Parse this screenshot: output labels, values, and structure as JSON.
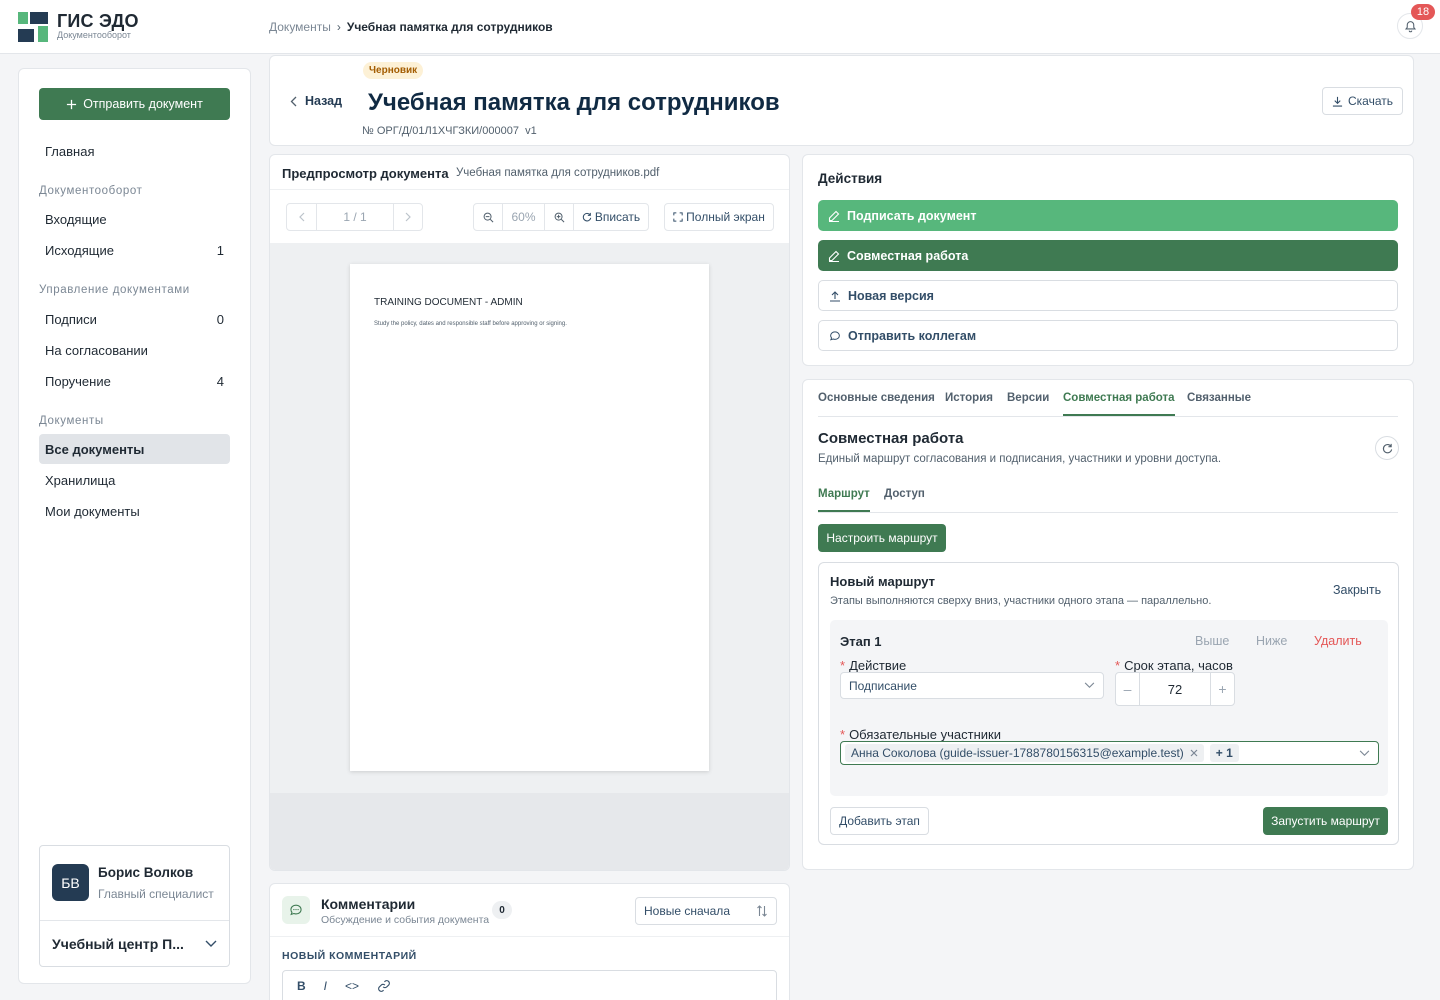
{
  "app": {
    "title": "ГИС ЭДО",
    "subtitle": "Документооборот",
    "notifications": "18"
  },
  "breadcrumb": {
    "root": "Документы",
    "sep": "›",
    "current": "Учебная памятка для сотрудников"
  },
  "sidebar": {
    "send_button": "Отправить документ",
    "home": "Главная",
    "groups": [
      {
        "title": "Документооборот",
        "items": [
          {
            "label": "Входящие",
            "count": ""
          },
          {
            "label": "Исходящие",
            "count": "1"
          }
        ]
      },
      {
        "title": "Управление документами",
        "items": [
          {
            "label": "Подписи",
            "count": "0"
          },
          {
            "label": "На согласовании",
            "count": ""
          },
          {
            "label": "Поручение",
            "count": "4"
          }
        ]
      },
      {
        "title": "Документы",
        "items": [
          {
            "label": "Все документы",
            "count": ""
          },
          {
            "label": "Хранилища",
            "count": ""
          },
          {
            "label": "Мои документы",
            "count": ""
          }
        ]
      }
    ],
    "user": {
      "initials": "БВ",
      "name": "Борис Волков",
      "role": "Главный специалист",
      "org": "Учебный центр П..."
    }
  },
  "header": {
    "status": "Черновик",
    "back": "Назад",
    "title": "Учебная памятка для сотрудников",
    "number": "№ ОРГ/Д/01Л1ХЧГЗКИ/000007",
    "version": "v1",
    "download": "Скачать"
  },
  "preview": {
    "title": "Предпросмотр документа",
    "file": "Учебная памятка для сотрудников.pdf",
    "page_indicator": "1 / 1",
    "zoom": "60%",
    "fit": "Вписать",
    "fullscreen": "Полный экран",
    "page_heading": "TRAINING DOCUMENT - ADMIN",
    "page_text": "Study the policy, dates and responsible staff before approving or signing."
  },
  "comments": {
    "title": "Комментарии",
    "subtitle": "Обсуждение и события документа",
    "count": "0",
    "sort": "Новые сначала",
    "new_label": "НОВЫЙ КОММЕНТАРИЙ",
    "tools": {
      "bold": "B",
      "italic": "I",
      "code": "<>"
    }
  },
  "actions": {
    "title": "Действия",
    "sign": "Подписать документ",
    "collab": "Совместная работа",
    "new_version": "Новая версия",
    "send": "Отправить коллегам"
  },
  "collab": {
    "tabs": [
      "Основные сведения",
      "История",
      "Версии",
      "Совместная работа",
      "Связанные"
    ],
    "title": "Совместная работа",
    "subtitle": "Единый маршрут согласования и подписания, участники и уровни доступа.",
    "subtabs": [
      "Маршрут",
      "Доступ"
    ],
    "setup_route": "Настроить маршрут",
    "route": {
      "title": "Новый маршрут",
      "subtitle": "Этапы выполняются сверху вниз, участники одного этапа — параллельно.",
      "close": "Закрыть",
      "stage": {
        "title": "Этап 1",
        "up": "Выше",
        "down": "Ниже",
        "delete": "Удалить",
        "action_label": "Действие",
        "action_value": "Подписание",
        "term_label": "Срок этапа, часов",
        "term_value": "72",
        "participants_label": "Обязательные участники",
        "participant": "Анна Соколова (guide-issuer-1788780156315@example.test)",
        "more": "+ 1"
      },
      "add_stage": "Добавить этап",
      "launch": "Запустить маршрут"
    }
  },
  "colors": {
    "accent": "#3f7a52",
    "accent_light": "#57b77c",
    "danger": "#e45757"
  }
}
